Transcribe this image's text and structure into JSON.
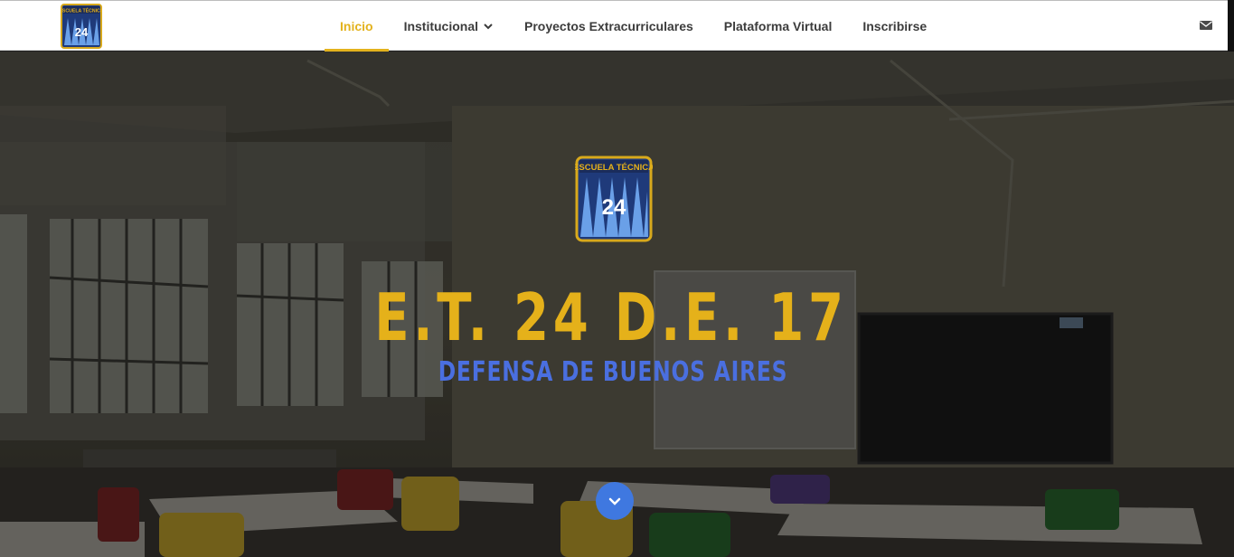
{
  "nav": {
    "logo_text": "ESCUELA TÉCNICA",
    "logo_number": "24",
    "items": [
      {
        "label": "Inicio",
        "active": true
      },
      {
        "label": "Institucional",
        "has_dropdown": true
      },
      {
        "label": "Proyectos Extracurriculares"
      },
      {
        "label": "Plataforma Virtual"
      },
      {
        "label": "Inscribirse"
      }
    ],
    "mail_icon": "envelope-icon"
  },
  "hero": {
    "emblem_text": "ESCUELA TÉCNICA",
    "emblem_number": "24",
    "title": "E.T. 24 D.E. 17",
    "subtitle": "DEFENSA DE BUENOS AIRES",
    "scroll_icon": "chevron-down-icon"
  },
  "colors": {
    "accent": "#e3b21d",
    "title": "#e5b11a",
    "subtitle": "#4a6fe0",
    "button": "#3f78e0",
    "nav_text": "#3c3c3c"
  }
}
